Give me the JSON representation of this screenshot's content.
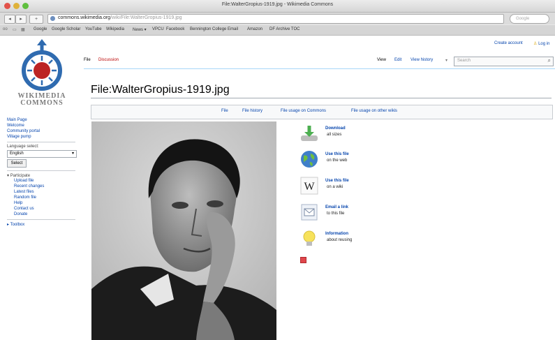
{
  "window": {
    "title": "File:WalterGropius-1919.jpg - Wikimedia Commons"
  },
  "toolbar": {
    "url_host": "commons.wikimedia.org",
    "url_path": "/wiki/File:WalterGropius-1919.jpg",
    "search_placeholder": "Google"
  },
  "bookmarks": [
    "Google",
    "Google Scholar",
    "YouTube",
    "Wikipedia",
    "News ▾",
    "VPCU",
    "Facebook",
    "Bennington College Email",
    "Amazon",
    "DF Archive TOC"
  ],
  "personal": {
    "create_account": "Create account",
    "login": "Log in"
  },
  "logo": {
    "line1": "WIKIMEDIA",
    "line2": "COMMONS"
  },
  "sidebar": {
    "nav": [
      "Main Page",
      "Welcome",
      "Community portal",
      "Village pump"
    ],
    "language_label": "Language select:",
    "language_value": "English",
    "select_button": "Select",
    "participate_heading": "Participate",
    "participate": [
      "Upload file",
      "Recent changes",
      "Latest files",
      "Random file",
      "Help",
      "Contact us",
      "Donate"
    ],
    "toolbox": "Toolbox"
  },
  "tabs": {
    "file": "File",
    "discussion": "Discussion",
    "view": "View",
    "edit": "Edit",
    "view_history": "View history",
    "search_placeholder": "Search"
  },
  "page_title": "File:WalterGropius-1919.jpg",
  "file_toc": [
    "File",
    "File history",
    "File usage on Commons",
    "File usage on other wikis"
  ],
  "actions": [
    {
      "link": "Download",
      "sub": "all sizes",
      "icon": "download-icon"
    },
    {
      "link": "Use this file",
      "sub": "on the web",
      "icon": "globe-icon"
    },
    {
      "link": "Use this file",
      "sub": "on a wiki",
      "icon": "wikipedia-w-icon"
    },
    {
      "link": "Email a link",
      "sub": "to this file",
      "icon": "email-icon"
    },
    {
      "link": "Information",
      "sub": "about reusing",
      "icon": "lightbulb-icon"
    }
  ]
}
